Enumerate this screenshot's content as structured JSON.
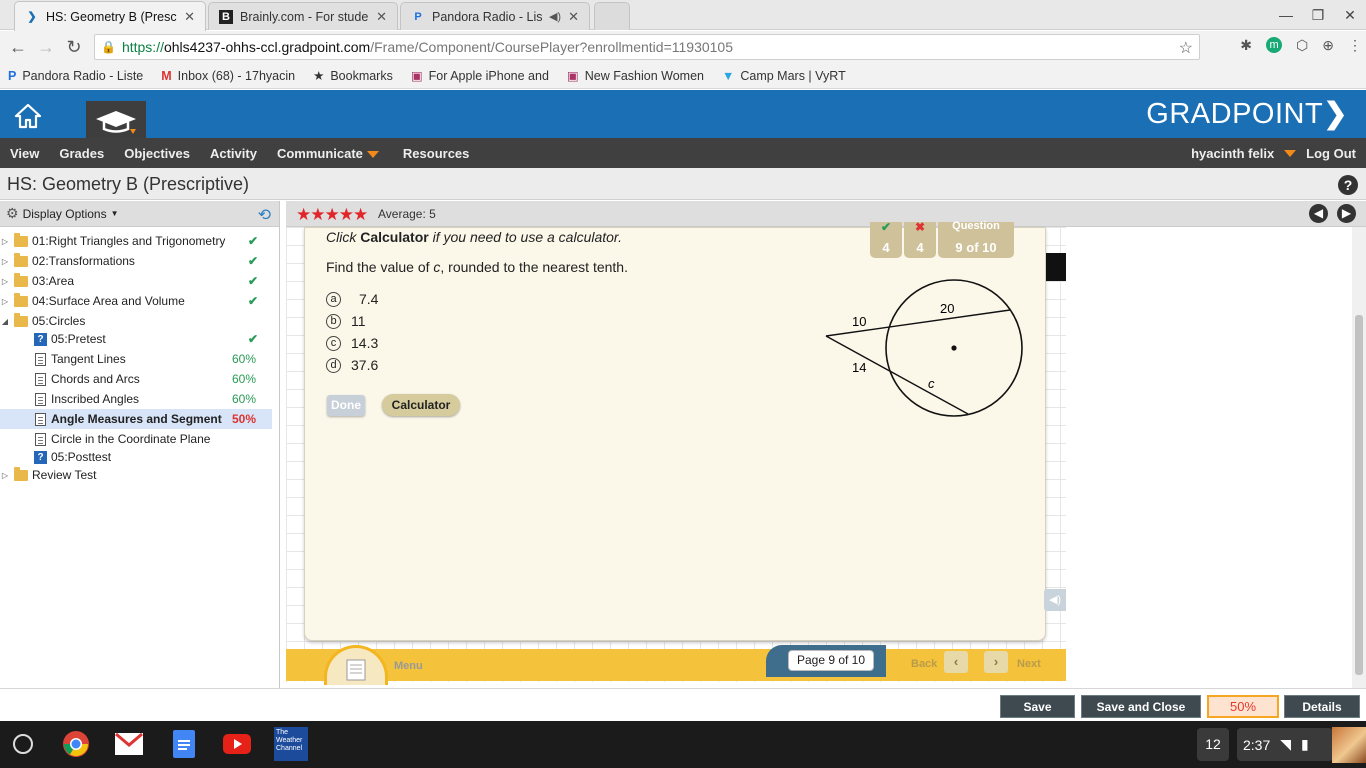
{
  "browser": {
    "tabs": [
      {
        "title": "HS: Geometry B (Prescrip",
        "active": true
      },
      {
        "title": "Brainly.com - For studen",
        "active": false
      },
      {
        "title": "Pandora Radio - Liste",
        "active": false
      }
    ],
    "url": {
      "scheme": "https://",
      "host": "ohls4237-ohhs-ccl.gradpoint.com",
      "path": "/Frame/Component/CoursePlayer?enrollmentid=11930105"
    },
    "bookmarks": [
      "Pandora Radio - Liste",
      "Inbox (68) - 17hyacin",
      "Bookmarks",
      "For Apple iPhone and",
      "New Fashion Women",
      "Camp Mars | VyRT"
    ]
  },
  "app": {
    "logo": "GRADPOINT",
    "menu": [
      "View",
      "Grades",
      "Objectives",
      "Activity",
      "Communicate",
      "Resources"
    ],
    "user": "hyacinth felix",
    "logout": "Log Out",
    "course_title": "HS: Geometry B (Prescriptive)",
    "help": "?"
  },
  "sidebar": {
    "display_options": "Display Options",
    "items": [
      {
        "label": "01:Right Triangles and Trigonometry",
        "type": "folder",
        "status": "✔"
      },
      {
        "label": "02:Transformations",
        "type": "folder",
        "status": "✔"
      },
      {
        "label": "03:Area",
        "type": "folder",
        "status": "✔"
      },
      {
        "label": "04:Surface Area and Volume",
        "type": "folder",
        "status": "✔"
      },
      {
        "label": "05:Circles",
        "type": "folder-open",
        "status": ""
      },
      {
        "label": "05:Pretest",
        "type": "quiz",
        "status": "✔"
      },
      {
        "label": "Tangent Lines",
        "type": "page",
        "status": "60%"
      },
      {
        "label": "Chords and Arcs",
        "type": "page",
        "status": "60%"
      },
      {
        "label": "Inscribed Angles",
        "type": "page",
        "status": "60%"
      },
      {
        "label": "Angle Measures and Segment",
        "type": "page",
        "status": "50%",
        "selected": true
      },
      {
        "label": "Circle in the Coordinate Plane",
        "type": "page",
        "status": ""
      },
      {
        "label": "05:Posttest",
        "type": "quiz",
        "status": ""
      },
      {
        "label": "Review Test",
        "type": "folder",
        "status": ""
      }
    ]
  },
  "rating": {
    "stars": "★★★★★",
    "average": "Average: 5"
  },
  "question": {
    "instruction_pre": "Click ",
    "instruction_bold": "Calculator",
    "instruction_post": " if you need to use a calculator.",
    "prompt_pre": "Find the value of ",
    "prompt_var": "c",
    "prompt_post": ", rounded to the nearest tenth.",
    "choices": [
      {
        "letter": "a",
        "text": "7.4"
      },
      {
        "letter": "b",
        "text": "11"
      },
      {
        "letter": "c",
        "text": "14.3"
      },
      {
        "letter": "d",
        "text": "37.6"
      }
    ],
    "done_label": "Done",
    "calculator_label": "Calculator",
    "score": {
      "correct": "4",
      "incorrect": "4",
      "question_label": "Question",
      "question_value": "9 of 10"
    },
    "diagram_labels": {
      "a": "10",
      "b": "20",
      "c": "14",
      "d": "c"
    }
  },
  "player_footer": {
    "menu": "Menu",
    "page": "Page  9 of 10",
    "back": "Back",
    "next": "Next"
  },
  "actions": {
    "save": "Save",
    "save_close": "Save and Close",
    "percent": "50%",
    "details": "Details"
  },
  "taskbar": {
    "notification_count": "12",
    "time": "2:37",
    "weather_label": "The Weather Channel"
  }
}
